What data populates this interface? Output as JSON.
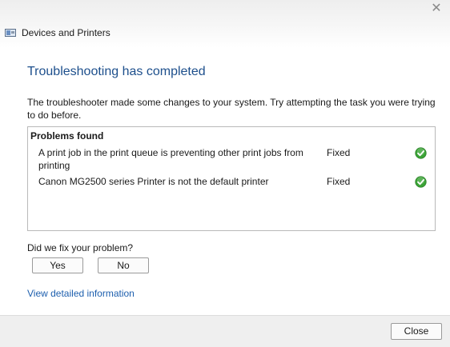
{
  "window": {
    "title": "Devices and Printers",
    "close_glyph": "✕"
  },
  "heading": "Troubleshooting has completed",
  "description": "The troubleshooter made some changes to your system. Try attempting the task you were trying to do before.",
  "problems": {
    "header": "Problems found",
    "items": [
      {
        "text": "A print job in the print queue is preventing other print jobs from printing",
        "status": "Fixed",
        "icon": "check-icon"
      },
      {
        "text": "Canon MG2500 series Printer is not the default printer",
        "status": "Fixed",
        "icon": "check-icon"
      }
    ]
  },
  "feedback": {
    "question": "Did we fix your problem?",
    "yes_label": "Yes",
    "no_label": "No"
  },
  "details_link": "View detailed information",
  "footer": {
    "close_label": "Close"
  },
  "colors": {
    "heading": "#1d4f8c",
    "link": "#1d5fae",
    "check": "#3aa335"
  }
}
